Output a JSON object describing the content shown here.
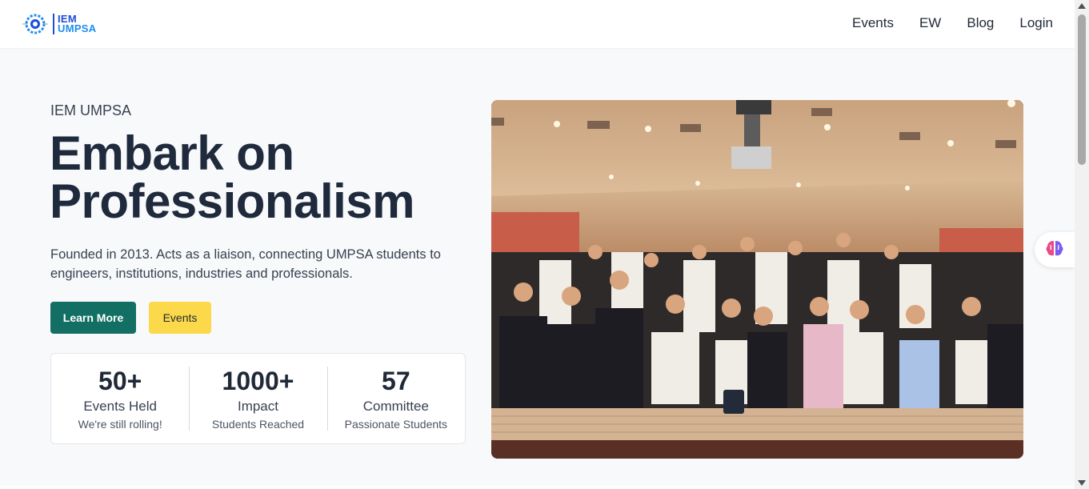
{
  "nav": {
    "logo_line1": "IEM",
    "logo_line2": "UMPSA",
    "links": [
      "Events",
      "EW",
      "Blog",
      "Login"
    ]
  },
  "hero": {
    "eyebrow": "IEM UMPSA",
    "headline_line1": "Embark on",
    "headline_line2": "Professionalism",
    "description": "Founded in 2013. Acts as a liaison, connecting UMPSA students to engineers, institutions, industries and professionals.",
    "primary_button": "Learn More",
    "secondary_button": "Events"
  },
  "stats": [
    {
      "value": "50+",
      "label": "Events Held",
      "sub": "We're still rolling!"
    },
    {
      "value": "1000+",
      "label": "Impact",
      "sub": "Students Reached"
    },
    {
      "value": "57",
      "label": "Committee",
      "sub": "Passionate Students"
    }
  ],
  "colors": {
    "primary": "#136f63",
    "secondary": "#fcd94a",
    "headline": "#1f2a3c",
    "logo_blue": "#1d4ed8"
  },
  "icons": {
    "ai_assistant": "brain-icon",
    "logo_emblem": "gear-icon"
  }
}
